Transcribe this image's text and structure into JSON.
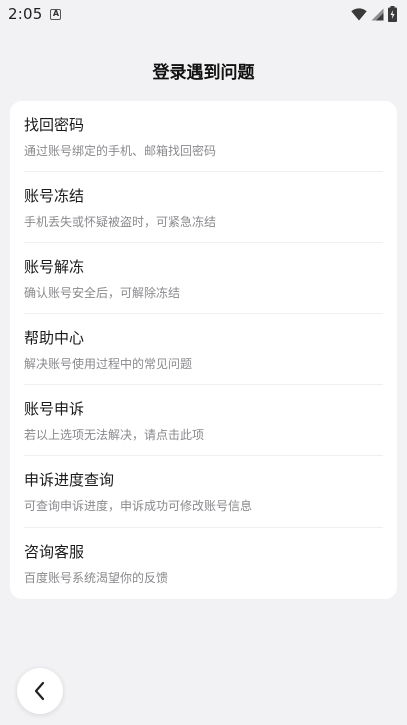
{
  "status_bar": {
    "time": "2:05",
    "notification_badge": "A",
    "icons": [
      "wifi-icon",
      "cell-signal-icon",
      "battery-icon"
    ]
  },
  "page": {
    "title": "登录遇到问题"
  },
  "menu": {
    "items": [
      {
        "title": "找回密码",
        "desc": "通过账号绑定的手机、邮箱找回密码"
      },
      {
        "title": "账号冻结",
        "desc": "手机丢失或怀疑被盗时，可紧急冻结"
      },
      {
        "title": "账号解冻",
        "desc": "确认账号安全后，可解除冻结"
      },
      {
        "title": "帮助中心",
        "desc": "解决账号使用过程中的常见问题"
      },
      {
        "title": "账号申诉",
        "desc": "若以上选项无法解决，请点击此项"
      },
      {
        "title": "申诉进度查询",
        "desc": "可查询申诉进度，申诉成功可修改账号信息"
      },
      {
        "title": "咨询客服",
        "desc": "百度账号系统渴望你的反馈"
      }
    ]
  },
  "nav": {
    "back_icon": "chevron-left-icon"
  }
}
